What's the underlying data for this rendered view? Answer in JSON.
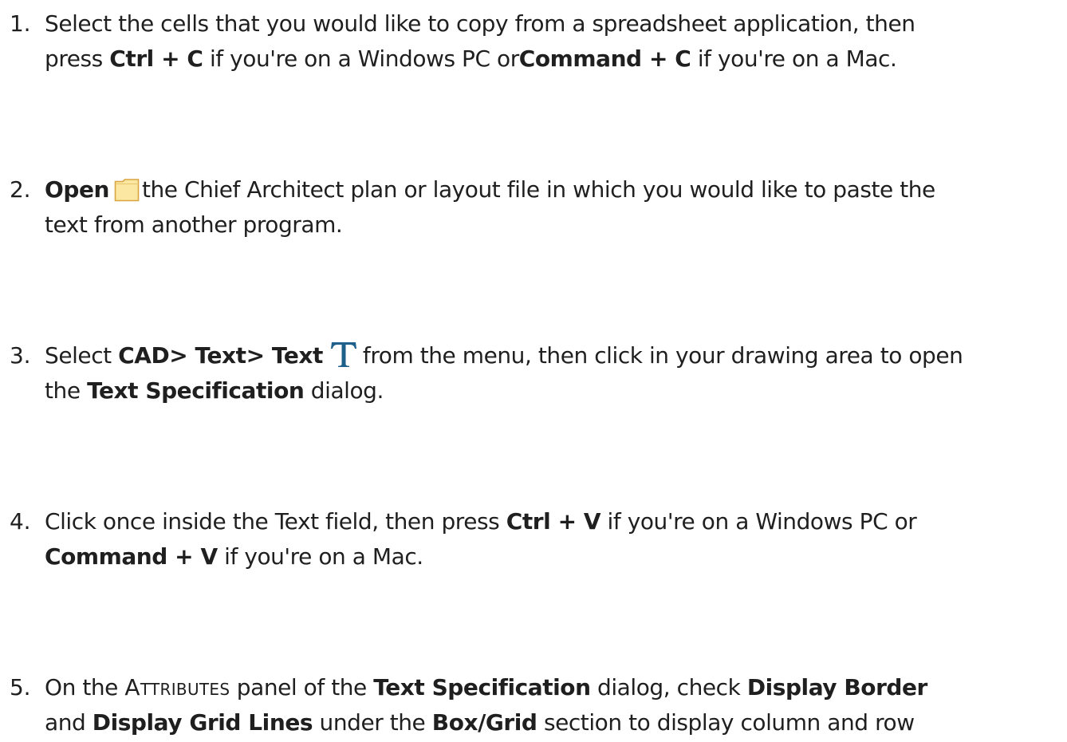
{
  "steps": [
    {
      "number": "1.",
      "line1_a": "Select the cells that you would like to copy from a spreadsheet application, then",
      "line2_a": "press ",
      "line2_b": "Ctrl + C",
      "line2_c": " if you're on a Windows PC or",
      "line2_d": "Command + C",
      "line2_e": " if you're on a Mac."
    },
    {
      "number": "2.",
      "line1_a": "Open",
      "line1_b": "the Chief Architect plan or layout file in which you would like to paste the",
      "line2_a": "text from another program.",
      "icon": "open-folder-icon"
    },
    {
      "number": "3.",
      "line1_a": "Select ",
      "line1_b": "CAD> Text> Text",
      "line1_c": "from the menu, then click in your drawing area to open",
      "line2_a": "the ",
      "line2_b": "Text Specification",
      "line2_c": " dialog.",
      "icon": "text-tool-icon"
    },
    {
      "number": "4.",
      "line1_a": "Click once inside the Text field, then press",
      "line1_b": "Ctrl + V",
      "line1_c": " if you're on a Windows PC or",
      "line2_a": "Command + V",
      "line2_b": " if you're on a Mac."
    },
    {
      "number": "5.",
      "line1_a": "On the ",
      "line1_b": "Attributes",
      "line1_c": " panel of the ",
      "line1_d": "Text Specification",
      "line1_e": " dialog, check ",
      "line1_f": "Display Border",
      "line2_a": "and ",
      "line2_b": "Display Grid Lines",
      "line2_c": " under the ",
      "line2_d": "Box/Grid",
      "line2_e": " section to display column and row"
    }
  ],
  "colors": {
    "text": "#1f1f1f",
    "folder_fill": "#fbe7a1",
    "folder_stroke": "#d9a441",
    "text_icon": "#1f5f8b"
  }
}
